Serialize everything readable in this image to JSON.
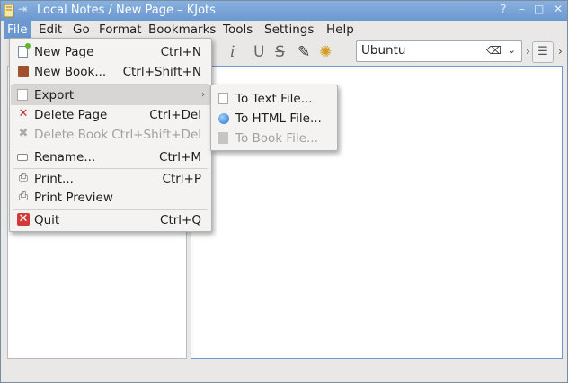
{
  "window": {
    "title": "Local Notes / New Page – KJots",
    "pin_icon": "⇥",
    "help_btn": "?",
    "min_btn": "–",
    "max_btn": "□",
    "close_btn": "✕"
  },
  "menubar": {
    "items": [
      "File",
      "Edit",
      "Go",
      "Format",
      "Bookmarks",
      "Tools",
      "Settings",
      "Help"
    ]
  },
  "toolbar": {
    "italic": "i",
    "underline": "U",
    "strike": "S",
    "text_color_icon": "✎",
    "highlight_icon": "✺",
    "font_value": "Ubuntu",
    "font_clear_icon": "⌫",
    "font_dropdown_icon": "⌄",
    "more_icon": "›",
    "align_icon": "☰"
  },
  "file_menu": {
    "items": [
      {
        "label": "New Page",
        "shortcut": "Ctrl+N",
        "icon": "new-page-icon",
        "glyph": "",
        "disabled": false
      },
      {
        "label": "New Book...",
        "shortcut": "Ctrl+Shift+N",
        "icon": "new-book-icon",
        "glyph": "",
        "disabled": false
      },
      {
        "label": "Export",
        "shortcut": "",
        "icon": "export-icon",
        "glyph": "",
        "disabled": false,
        "submenu": true
      },
      {
        "label": "Delete Page",
        "shortcut": "Ctrl+Del",
        "icon": "delete-page-icon",
        "glyph": "✕",
        "disabled": false
      },
      {
        "label": "Delete Book",
        "shortcut": "Ctrl+Shift+Del",
        "icon": "delete-book-icon",
        "glyph": "✖",
        "disabled": true
      },
      {
        "label": "Rename...",
        "shortcut": "Ctrl+M",
        "icon": "rename-icon",
        "glyph": "",
        "disabled": false
      },
      {
        "label": "Print...",
        "shortcut": "Ctrl+P",
        "icon": "print-icon",
        "glyph": "⎙",
        "disabled": false
      },
      {
        "label": "Print Preview",
        "shortcut": "",
        "icon": "print-preview-icon",
        "glyph": "⎙",
        "disabled": false
      },
      {
        "label": "Quit",
        "shortcut": "Ctrl+Q",
        "icon": "quit-icon",
        "glyph": "✕",
        "disabled": false
      }
    ],
    "submenu_arrow": "›"
  },
  "export_menu": {
    "items": [
      {
        "label": "To Text File...",
        "icon": "text-file-icon",
        "disabled": false
      },
      {
        "label": "To HTML File...",
        "icon": "html-file-icon",
        "disabled": false
      },
      {
        "label": "To Book File...",
        "icon": "book-file-icon",
        "disabled": true
      }
    ]
  },
  "colors": {
    "titlebar": "#6b98cf",
    "menu_bg": "#f4f3f2",
    "highlight": "#d7d6d5",
    "editor_border": "#6b98cf"
  }
}
